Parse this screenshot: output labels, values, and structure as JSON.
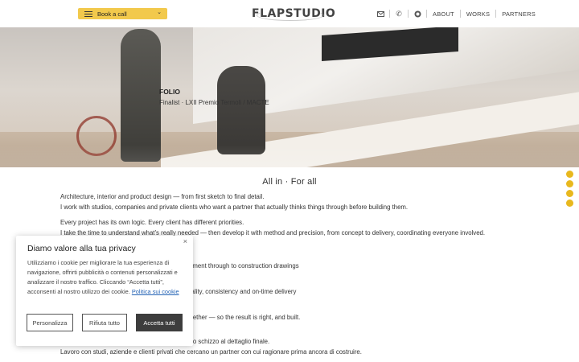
{
  "header": {
    "book_label": "Book a call",
    "logo_text": "FLAPSTUDIO",
    "icons": [
      "mail-icon",
      "phone-icon",
      "whatsapp-icon"
    ],
    "nav": [
      "ABOUT",
      "WORKS",
      "PARTNERS"
    ]
  },
  "hero": {
    "title": "FOLIO",
    "subtitle": "Finalist · LXII Premio Termoli / MACTE"
  },
  "content": {
    "section_title": "All in · For all",
    "p1": [
      "Architecture, interior and product design — from first sketch to final detail.",
      "I work with studios, companies and private clients who want a partner that actually thinks things through before building them."
    ],
    "p2": [
      "Every project has its own logic. Every client has different priorities.",
      "I take the time to understand what’s really needed — then develop it with method and precision, from concept to delivery, coordinating everyone involved."
    ],
    "fragments": [
      "lopment through to construction drawings",
      "ns",
      "quality, consistency and on-time delivery",
      "t.",
      "together — so the result is right, and built."
    ],
    "p_it": [
      "rimo schizzo al dettaglio finale.",
      "Lavoro con studi, aziende e clienti privati che cercano un partner con cui ragionare prima ancora di costruire."
    ]
  },
  "cookie": {
    "title": "Diamo valore alla tua privacy",
    "body": "Utilizziamo i cookie per migliorare la tua esperienza di navigazione, offrirti pubblicità o contenuti personalizzati e analizzare il nostro traffico. Cliccando “Accetta tutti”, acconsenti al nostro utilizzo dei cookie.",
    "policy_link": "Politica sui cookie",
    "btn_customize": "Personalizza",
    "btn_reject": "Rifiuta tutto",
    "btn_accept": "Accetta tutti",
    "close": "×"
  },
  "colors": {
    "accent": "#f2c94c",
    "dot": "#e8b81e",
    "link": "#2463b5"
  }
}
